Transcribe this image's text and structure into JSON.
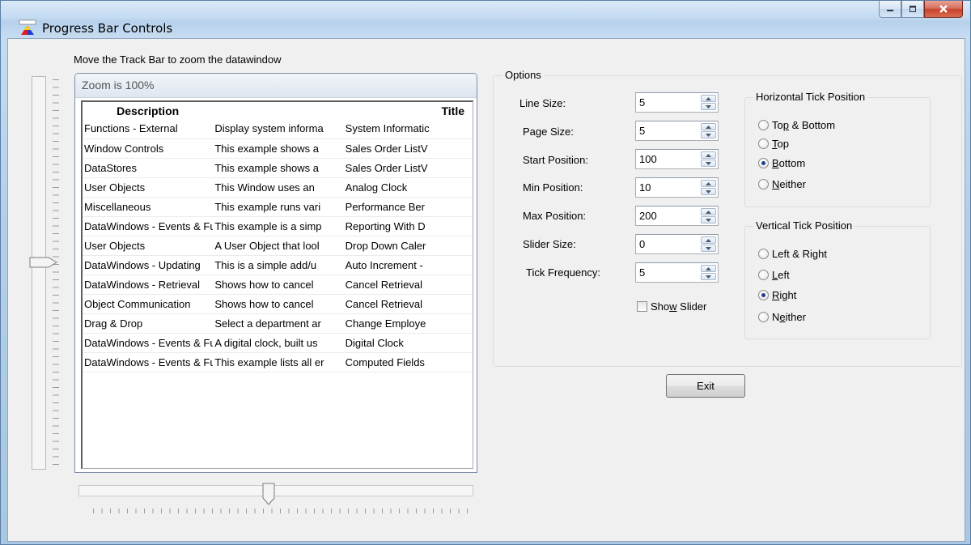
{
  "window": {
    "title": "Progress Bar Controls",
    "minimize_icon": "minimize-icon",
    "maximize_icon": "maximize-icon",
    "close_icon": "close-icon"
  },
  "hint": "Move the Track Bar to zoom the datawindow",
  "datawindow": {
    "zoom_title": "Zoom is 100%",
    "columns": [
      "Description",
      "",
      "Title"
    ],
    "rows": [
      [
        "Functions - External",
        "Display system informa",
        "System Informatic"
      ],
      [
        "Window Controls",
        "This example shows a",
        "Sales Order ListV"
      ],
      [
        "DataStores",
        "This example shows a",
        "Sales Order ListV"
      ],
      [
        "User Objects",
        "This Window uses an",
        "Analog Clock"
      ],
      [
        "Miscellaneous",
        "This example runs vari",
        "Performance Ber"
      ],
      [
        "DataWindows - Events & Fun",
        "This example is a simp",
        "Reporting With D"
      ],
      [
        "User Objects",
        "A User Object that lool",
        "Drop Down Caler"
      ],
      [
        "DataWindows - Updating",
        "This is a simple add/u",
        "Auto Increment -"
      ],
      [
        "DataWindows - Retrieval",
        "Shows how to cancel",
        "Cancel Retrieval"
      ],
      [
        "Object Communication",
        "Shows how to cancel",
        "Cancel Retrieval"
      ],
      [
        "Drag & Drop",
        "Select a department ar",
        "Change Employe"
      ],
      [
        "DataWindows - Events & Fun",
        "A digital clock, built us",
        "Digital Clock"
      ],
      [
        "DataWindows - Events & Fun",
        "This example lists all er",
        "Computed Fields"
      ]
    ]
  },
  "trackbars": {
    "vertical_position": 0.56,
    "horizontal_position": 0.47
  },
  "options": {
    "group_label": "Options",
    "fields": [
      {
        "label": "Line Size:",
        "value": "5"
      },
      {
        "label": "Page Size:",
        "value": "5"
      },
      {
        "label": "Start Position:",
        "value": "100"
      },
      {
        "label": "Min Position:",
        "value": "10"
      },
      {
        "label": "Max Position:",
        "value": "200"
      },
      {
        "label": "Slider Size:",
        "value": "0"
      },
      {
        "label": "Tick Frequency:",
        "value": "5"
      }
    ],
    "show_slider": {
      "label_pre": "Sho",
      "label_ul": "w",
      "label_post": " Slider",
      "checked": false
    },
    "horizontal_tick": {
      "label": "Horizontal Tick Position",
      "options": [
        {
          "pre": "To",
          "ul": "p",
          "post": " & Bottom",
          "selected": false
        },
        {
          "pre": "",
          "ul": "T",
          "post": "op",
          "selected": false
        },
        {
          "pre": "",
          "ul": "B",
          "post": "ottom",
          "selected": true
        },
        {
          "pre": "",
          "ul": "N",
          "post": "either",
          "selected": false
        }
      ]
    },
    "vertical_tick": {
      "label": "Vertical Tick Position",
      "options": [
        {
          "pre": "Left & Ri",
          "ul": "g",
          "post": "ht",
          "selected": false
        },
        {
          "pre": "",
          "ul": "L",
          "post": "eft",
          "selected": false
        },
        {
          "pre": "",
          "ul": "R",
          "post": "ight",
          "selected": true
        },
        {
          "pre": "N",
          "ul": "e",
          "post": "ither",
          "selected": false
        }
      ]
    }
  },
  "exit_label": "Exit"
}
